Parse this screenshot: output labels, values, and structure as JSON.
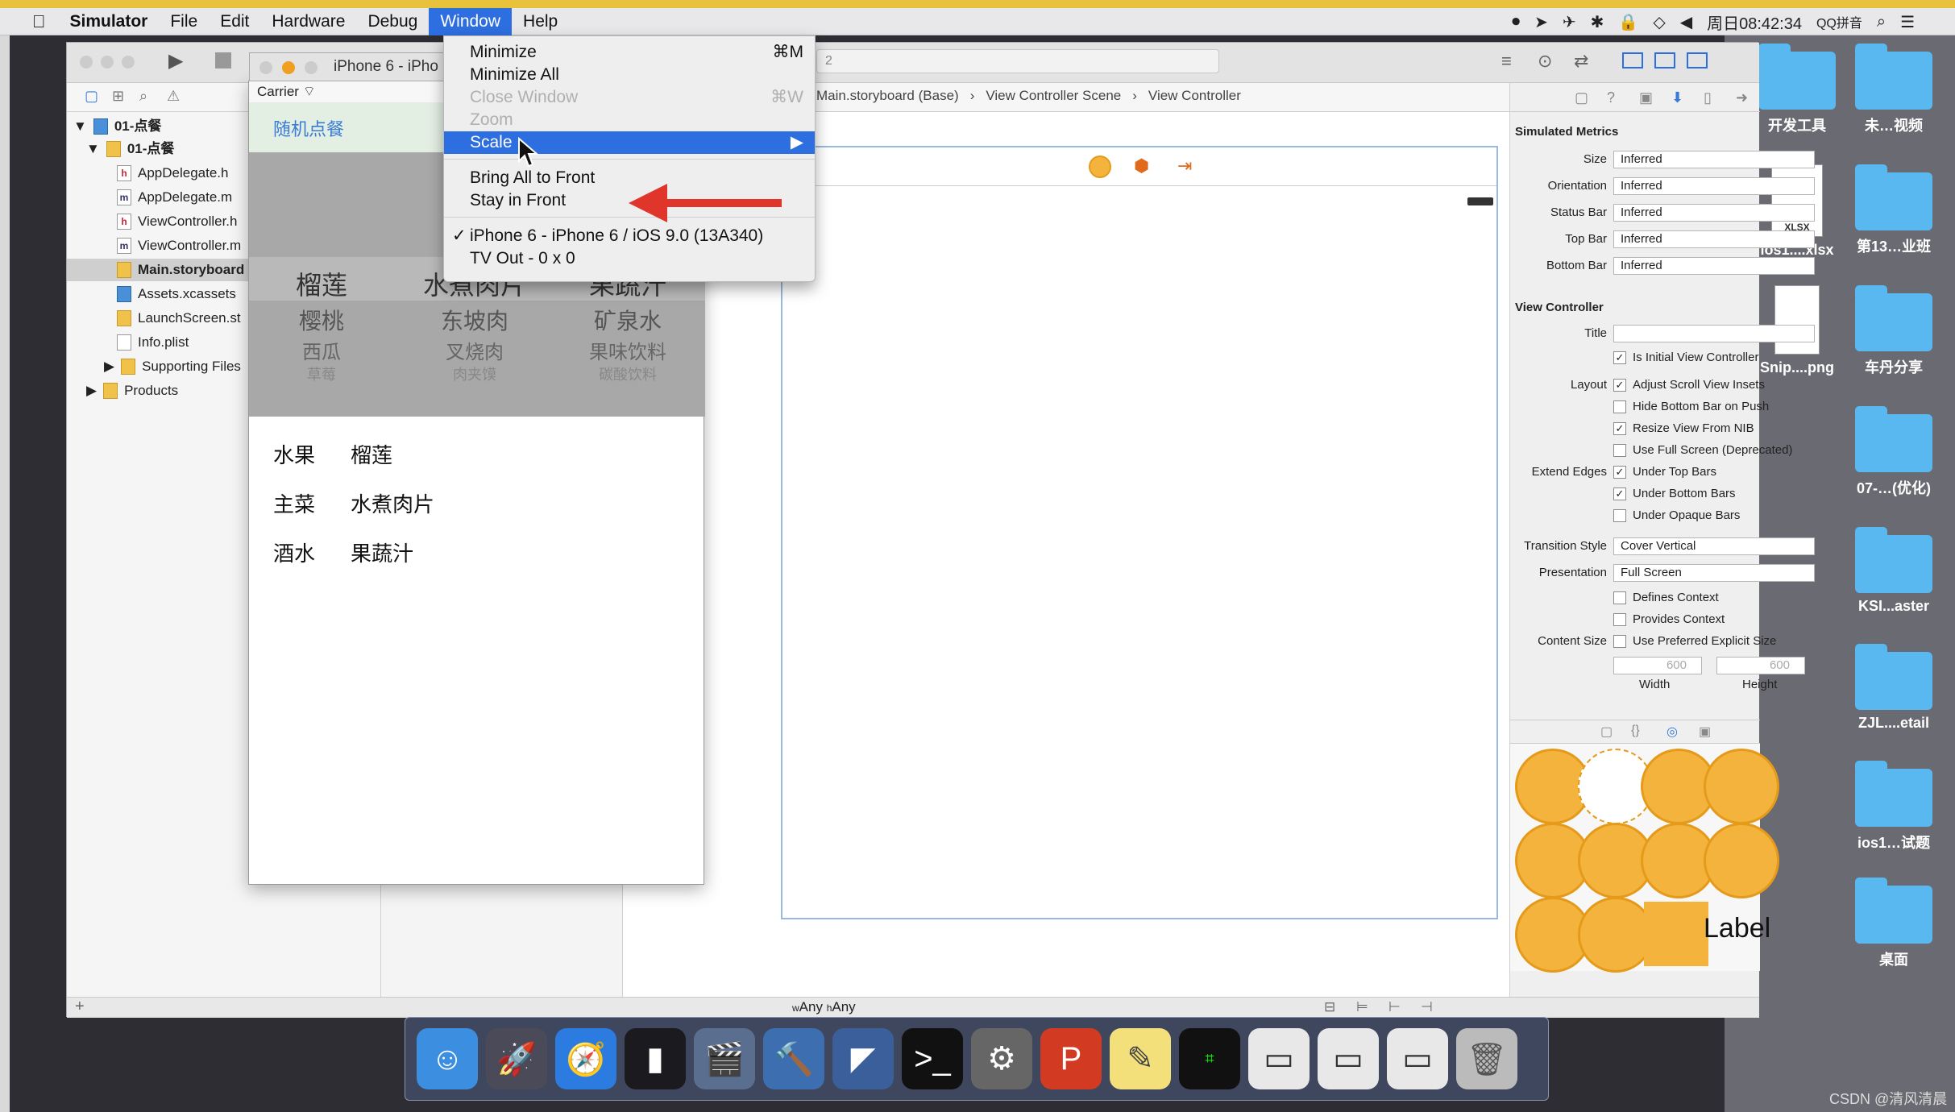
{
  "menubar": {
    "items": [
      "Simulator",
      "File",
      "Edit",
      "Hardware",
      "Debug",
      "Window",
      "Help"
    ],
    "clock": "周日08:42:34",
    "input_method": "QQ拼音"
  },
  "window_menu": {
    "items": [
      {
        "label": "Minimize",
        "shortcut": "⌘M"
      },
      {
        "label": "Minimize All",
        "shortcut": ""
      },
      {
        "label": "Close Window",
        "shortcut": "⌘W"
      },
      {
        "label": "Zoom",
        "shortcut": ""
      },
      {
        "label": "Scale",
        "shortcut": ""
      },
      {
        "label": "Bring All to Front",
        "shortcut": ""
      },
      {
        "label": "Stay in Front",
        "shortcut": ""
      },
      {
        "label": "iPhone 6 - iPhone 6 / iOS 9.0 (13A340)",
        "shortcut": "",
        "checked": "✓"
      },
      {
        "label": "TV Out - 0 x 0",
        "shortcut": ""
      }
    ]
  },
  "simulator": {
    "title": "iPhone 6 - iPho",
    "carrier": "Carrier",
    "nav_button": "随机点餐",
    "picker": {
      "col1": [
        "榴莲",
        "樱桃",
        "西瓜",
        "草莓"
      ],
      "col2": [
        "水煮肉片",
        "东坡肉",
        "叉烧肉",
        "肉夹馍"
      ],
      "col3": [
        "果蔬汁",
        "矿泉水",
        "果味饮料",
        "碳酸饮料"
      ]
    },
    "rows": [
      {
        "label": "水果",
        "value": "榴莲"
      },
      {
        "label": "主菜",
        "value": "水煮肉片"
      },
      {
        "label": "酒水",
        "value": "果蔬汁"
      }
    ]
  },
  "navigator": {
    "items": [
      {
        "label": "01-点餐",
        "kind": "project"
      },
      {
        "label": "01-点餐",
        "kind": "folder"
      },
      {
        "label": "AppDelegate.h",
        "kind": "h"
      },
      {
        "label": "AppDelegate.m",
        "kind": "m"
      },
      {
        "label": "ViewController.h",
        "kind": "h"
      },
      {
        "label": "ViewController.m",
        "kind": "m"
      },
      {
        "label": "Main.storyboard",
        "kind": "storyboard"
      },
      {
        "label": "Assets.xcassets",
        "kind": "assets"
      },
      {
        "label": "LaunchScreen.st",
        "kind": "storyboard"
      },
      {
        "label": "Info.plist",
        "kind": "plist"
      },
      {
        "label": "Supporting Files",
        "kind": "folder"
      },
      {
        "label": "Products",
        "kind": "folder"
      }
    ]
  },
  "breadcrumb": [
    "Main.storyboard (Base)",
    "View Controller Scene",
    "View Controller"
  ],
  "toolbar": {
    "scheme_suffix": "2"
  },
  "size_class": {
    "w": "Any",
    "h": "Any",
    "w_prefix": "w",
    "h_prefix": "h"
  },
  "inspector": {
    "simulated_metrics_title": "Simulated Metrics",
    "metrics": [
      {
        "label": "Size",
        "value": "Inferred"
      },
      {
        "label": "Orientation",
        "value": "Inferred"
      },
      {
        "label": "Status Bar",
        "value": "Inferred"
      },
      {
        "label": "Top Bar",
        "value": "Inferred"
      },
      {
        "label": "Bottom Bar",
        "value": "Inferred"
      }
    ],
    "vc_title": "View Controller",
    "title_label": "Title",
    "initial_vc": "Is Initial View Controller",
    "layout_label": "Layout",
    "layout_opts": [
      {
        "label": "Adjust Scroll View Insets",
        "checked": true
      },
      {
        "label": "Hide Bottom Bar on Push",
        "checked": false
      },
      {
        "label": "Resize View From NIB",
        "checked": true
      },
      {
        "label": "Use Full Screen (Deprecated)",
        "checked": false
      }
    ],
    "extend_label": "Extend Edges",
    "extend_opts": [
      {
        "label": "Under Top Bars",
        "checked": true
      },
      {
        "label": "Under Bottom Bars",
        "checked": true
      },
      {
        "label": "Under Opaque Bars",
        "checked": false
      }
    ],
    "transition_label": "Transition Style",
    "transition_value": "Cover Vertical",
    "presentation_label": "Presentation",
    "presentation_value": "Full Screen",
    "defines_context": "Defines Context",
    "provides_context": "Provides Context",
    "content_size_label": "Content Size",
    "use_preferred": "Use Preferred Explicit Size",
    "width_value": "600",
    "height_value": "600",
    "width_label": "Width",
    "height_label": "Height",
    "library_label": "Label"
  },
  "desktop": {
    "items": [
      "开发工具",
      "未…视频",
      "ios1....xlsx",
      "第13…业班",
      "Snip....png",
      "车丹分享",
      "07-…(优化)",
      "KSI...aster",
      "ZJL....etail",
      "ios1…试题",
      "桌面"
    ]
  },
  "watermark": "CSDN @清风清晨",
  "colors": {
    "accent": "#2d6fe0",
    "arrow": "#e0352b",
    "orange": "#f3b33d"
  }
}
